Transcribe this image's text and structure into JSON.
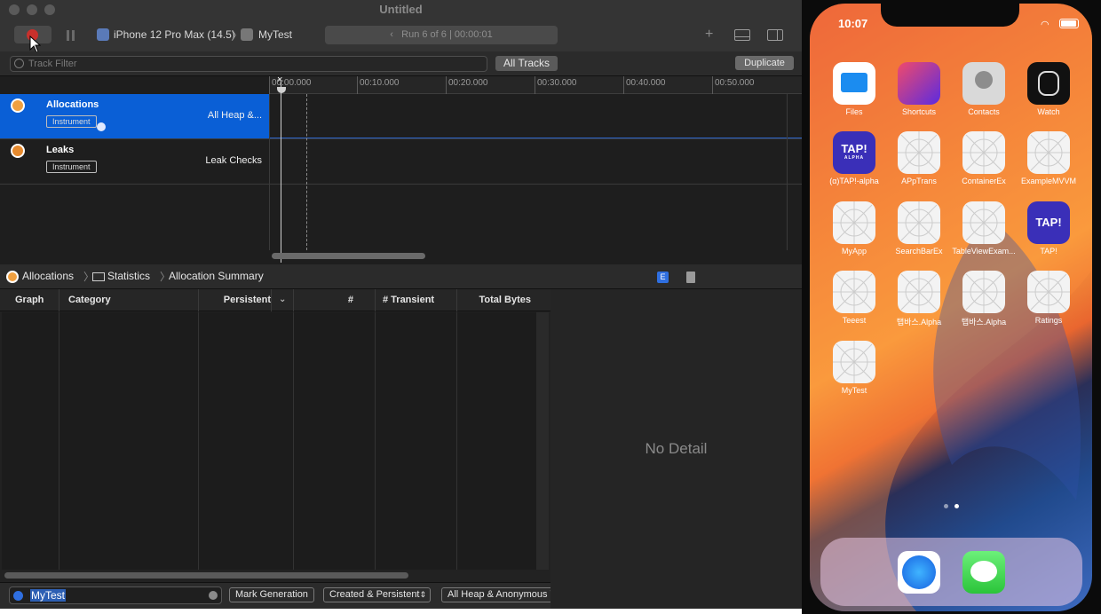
{
  "window": {
    "title": "Untitled"
  },
  "toolbar": {
    "device": "iPhone 12 Pro Max (14.5)",
    "target": "MyTest",
    "run_status": "Run 6 of 6  |  00:00:01"
  },
  "filter": {
    "placeholder": "Track Filter",
    "all_tracks": "All Tracks",
    "duplicate": "Duplicate"
  },
  "ruler": {
    "ticks": [
      "00:00.000",
      "00:10.000",
      "00:20.000",
      "00:30.000",
      "00:40.000",
      "00:50.000"
    ]
  },
  "tracks": [
    {
      "name": "Allocations",
      "tag": "Instrument",
      "desc": "All Heap &..."
    },
    {
      "name": "Leaks",
      "tag": "Instrument",
      "desc": "Leak Checks"
    }
  ],
  "jumpbar": {
    "item1": "Allocations",
    "item2": "Statistics",
    "item3": "Allocation Summary"
  },
  "table": {
    "columns": [
      "Graph",
      "Category",
      "Persistent",
      "#",
      "# Transient",
      "Total Bytes"
    ]
  },
  "detail": {
    "empty": "No Detail"
  },
  "footer": {
    "search_value": "MyTest",
    "mark_generation": "Mark Generation",
    "created_persistent": "Created & Persistent",
    "heap_filter": "All Heap & Anonymous V"
  },
  "phone": {
    "time": "10:07",
    "apps": [
      {
        "label": "Files"
      },
      {
        "label": "Shortcuts"
      },
      {
        "label": "Contacts"
      },
      {
        "label": "Watch"
      },
      {
        "label": "(α)TAP!-alpha"
      },
      {
        "label": "APpTrans"
      },
      {
        "label": "ContainerEx"
      },
      {
        "label": "ExampleMVVM"
      },
      {
        "label": "MyApp"
      },
      {
        "label": "SearchBarEx"
      },
      {
        "label": "TableViewExam..."
      },
      {
        "label": "TAP!"
      },
      {
        "label": "Teeest"
      },
      {
        "label": "탭바스.Alpha"
      },
      {
        "label": "탭바스.Alpha"
      },
      {
        "label": "Ratings"
      },
      {
        "label": "MyTest"
      }
    ],
    "tap_logo": "TAP!",
    "tap_alpha_sub": "ALPHA"
  },
  "colors": {
    "selection": "#0a5fd6",
    "record": "#c9302c",
    "instrument_icon": "#f0a040"
  }
}
